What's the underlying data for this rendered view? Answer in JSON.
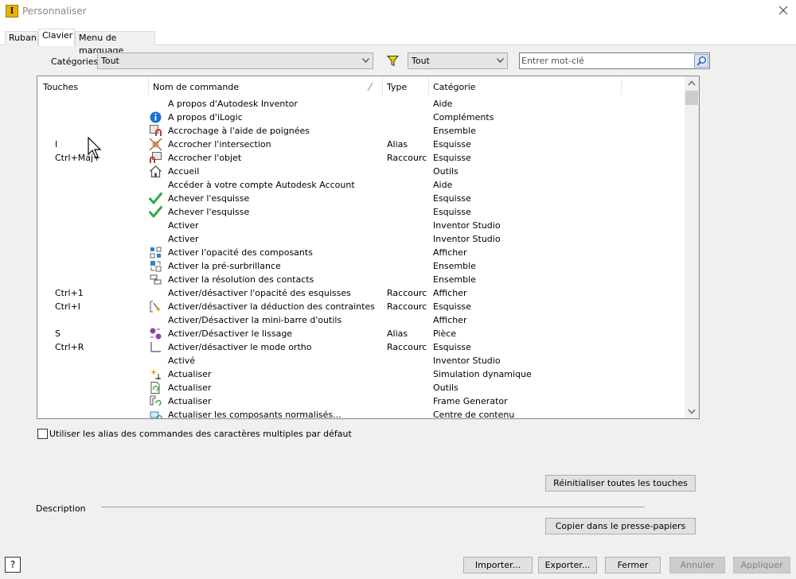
{
  "window": {
    "title": "Personnaliser",
    "icon": "inventor-app-icon"
  },
  "tabs": [
    {
      "label": "Ruban",
      "active": false
    },
    {
      "label": "Clavier",
      "active": true
    },
    {
      "label": "Menu de marquage",
      "active": false
    }
  ],
  "filters": {
    "categories_label": "Catégories:",
    "categories_value": "Tout",
    "filter_value": "Tout",
    "search_placeholder": "Entrer mot-clé"
  },
  "table": {
    "columns": [
      "Touches",
      "Nom de commande",
      "Type",
      "Catégorie"
    ],
    "rows": [
      {
        "keys": "",
        "icon": "",
        "name": "A propos d'Autodesk Inventor",
        "type": "",
        "category": "Aide"
      },
      {
        "keys": "",
        "icon": "info-icon",
        "name": "A propos d'iLogic",
        "type": "",
        "category": "Compléments"
      },
      {
        "keys": "",
        "icon": "grip-snap-icon",
        "name": "Accrochage à l'aide de poignées",
        "type": "",
        "category": "Ensemble"
      },
      {
        "keys": "I",
        "icon": "intersection-snap-icon",
        "name": "Accrocher l'intersection",
        "type": "Alias",
        "category": "Esquisse"
      },
      {
        "keys": "Ctrl+Maj+",
        "icon": "object-snap-icon",
        "name": "Accrocher l'objet",
        "type": "Raccourci",
        "category": "Esquisse"
      },
      {
        "keys": "",
        "icon": "home-icon",
        "name": "Accueil",
        "type": "",
        "category": "Outils"
      },
      {
        "keys": "",
        "icon": "",
        "name": "Accéder à votre compte Autodesk Account",
        "type": "",
        "category": "Aide"
      },
      {
        "keys": "",
        "icon": "checkmark-icon",
        "name": "Achever l'esquisse",
        "type": "",
        "category": "Esquisse"
      },
      {
        "keys": "",
        "icon": "checkmark-icon",
        "name": "Achever l'esquisse",
        "type": "",
        "category": "Esquisse"
      },
      {
        "keys": "",
        "icon": "",
        "name": "Activer",
        "type": "",
        "category": "Inventor Studio"
      },
      {
        "keys": "",
        "icon": "",
        "name": "Activer",
        "type": "",
        "category": "Inventor Studio"
      },
      {
        "keys": "",
        "icon": "component-opacity-icon",
        "name": "Activer l'opacité des composants",
        "type": "",
        "category": "Afficher"
      },
      {
        "keys": "",
        "icon": "prehighlight-icon",
        "name": "Activer la pré-surbrillance",
        "type": "",
        "category": "Ensemble"
      },
      {
        "keys": "",
        "icon": "contact-solver-icon",
        "name": "Activer la résolution des contacts",
        "type": "",
        "category": "Ensemble"
      },
      {
        "keys": "Ctrl+1",
        "icon": "",
        "name": "Activer/désactiver l'opacité des esquisses",
        "type": "Raccourci",
        "category": "Afficher"
      },
      {
        "keys": "Ctrl+I",
        "icon": "constraint-inference-icon",
        "name": "Activer/désactiver la déduction des contraintes",
        "type": "Raccourci",
        "category": "Esquisse"
      },
      {
        "keys": "",
        "icon": "",
        "name": "Activer/Désactiver la mini-barre d'outils",
        "type": "",
        "category": "Afficher"
      },
      {
        "keys": "S",
        "icon": "smoothing-icon",
        "name": "Activer/Désactiver le lissage",
        "type": "Alias",
        "category": "Pièce"
      },
      {
        "keys": "Ctrl+R",
        "icon": "ortho-mode-icon",
        "name": "Activer/désactiver le mode ortho",
        "type": "Raccourci",
        "category": "Esquisse"
      },
      {
        "keys": "",
        "icon": "",
        "name": "Activé",
        "type": "",
        "category": "Inventor Studio"
      },
      {
        "keys": "",
        "icon": "dynamic-update-icon",
        "name": "Actualiser",
        "type": "",
        "category": "Simulation dynamique"
      },
      {
        "keys": "",
        "icon": "document-update-icon",
        "name": "Actualiser",
        "type": "",
        "category": "Outils"
      },
      {
        "keys": "",
        "icon": "frame-update-icon",
        "name": "Actualiser",
        "type": "",
        "category": "Frame Generator"
      },
      {
        "keys": "",
        "icon": "standard-parts-update-icon",
        "name": "Actualiser les composants normalisés...",
        "type": "",
        "category": "Centre de contenu"
      }
    ]
  },
  "options": {
    "alias_checkbox_label": "Utiliser les alias des commandes des caractères multiples par défaut",
    "alias_checked": false
  },
  "buttons": {
    "reset_all": "Réinitialiser toutes les touches",
    "copy_clipboard": "Copier dans le presse-papiers",
    "import": "Importer...",
    "export": "Exporter...",
    "close": "Fermer",
    "cancel": "Annuler",
    "apply": "Appliquer"
  },
  "description_label": "Description",
  "colors": {
    "check_green": "#2eaa4a",
    "info_blue": "#1e73d2",
    "magnet_red": "#c0392b",
    "filter_yellow": "#f2d600"
  }
}
